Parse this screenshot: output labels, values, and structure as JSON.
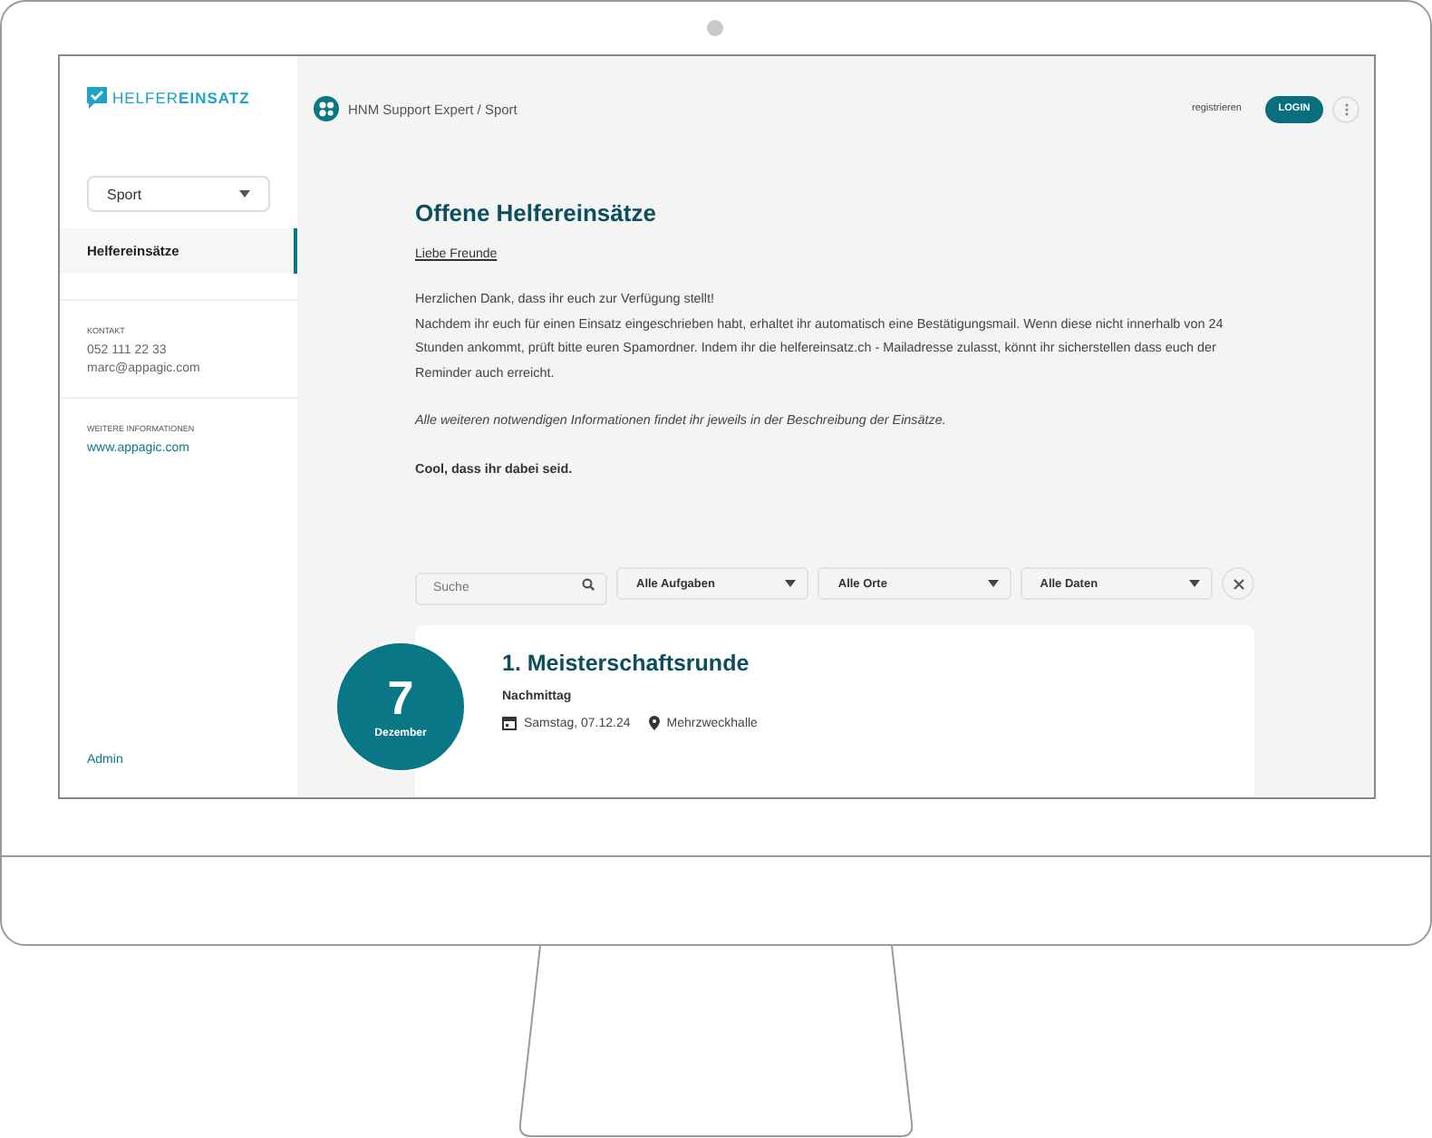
{
  "logo": {
    "text_light": "HELFER",
    "text_bold": "EINSATZ"
  },
  "sidebar": {
    "select": "Sport",
    "nav": [
      {
        "label": "Helfereinsätze",
        "selected": true
      }
    ],
    "contact": {
      "heading": "KONTAKT",
      "phone": "052 111 22 33",
      "email": "marc@appagic.com"
    },
    "info": {
      "heading": "WEITERE INFORMATIONEN",
      "link": "www.appagic.com"
    },
    "footer_link": "Admin"
  },
  "header": {
    "breadcrumb": "HNM Support Expert / Sport",
    "register": "registrieren",
    "login": "LOGIN"
  },
  "content": {
    "title": "Offene Helfereinsätze",
    "greeting": "Liebe Freunde",
    "paragraphs": [
      "Herzlichen Dank, dass ihr euch zur Verfügung stellt!",
      "Nachdem ihr euch für einen Einsatz eingeschrieben habt, erhaltet ihr automatisch eine Bestätigungsmail. Wenn diese nicht innerhalb von 24 Stunden ankommt, prüft bitte euren Spamordner. Indem ihr die helfereinsatz.ch - Mailadresse zulasst, könnt ihr sicherstellen dass euch der Reminder auch erreicht."
    ],
    "note": "Alle weiteren notwendigen Informationen findet ihr jeweils in der Beschreibung der Einsätze.",
    "closing": "Cool, dass ihr dabei seid."
  },
  "filters": {
    "search_placeholder": "Suche",
    "dropdowns": [
      "Alle Aufgaben",
      "Alle Orte",
      "Alle Daten"
    ]
  },
  "events": [
    {
      "day": "7",
      "month": "Dezember",
      "title": "1. Meisterschaftsrunde",
      "time_of_day": "Nachmittag",
      "date": "Samstag, 07.12.24",
      "location": "Mehrzweckhalle"
    }
  ]
}
